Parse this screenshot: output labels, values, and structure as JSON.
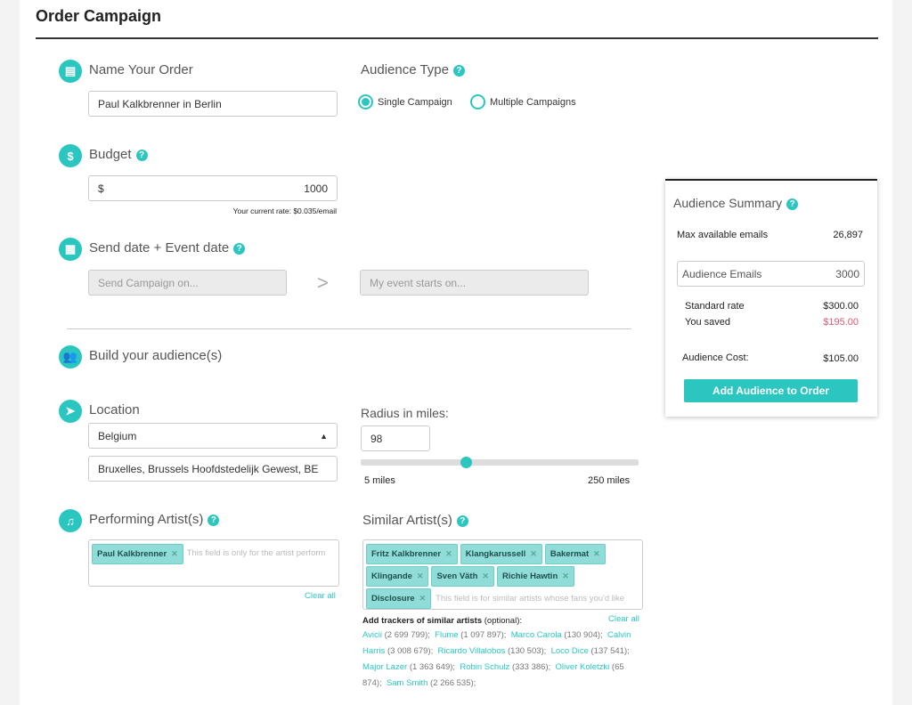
{
  "page_title": "Order Campaign",
  "name_order": {
    "label": "Name Your Order",
    "value": "Paul Kalkbrenner in Berlin"
  },
  "audience_type": {
    "label": "Audience Type",
    "options": [
      "Single Campaign",
      "Multiple Campaigns"
    ],
    "selected": "Single Campaign"
  },
  "budget": {
    "label": "Budget",
    "currency": "$",
    "value": "1000",
    "rate": "Your current rate: $0.035/email"
  },
  "dates": {
    "label": "Send date + Event date",
    "send_placeholder": "Send Campaign on...",
    "arrow": ">",
    "event_placeholder": "My event starts on..."
  },
  "build": {
    "label": "Build your audience(s)"
  },
  "location": {
    "label": "Location",
    "country": "Belgium",
    "city": "Bruxelles, Brussels Hoofdstedelijk Gewest, BE"
  },
  "radius": {
    "label": "Radius in miles:",
    "value": "98",
    "min_label": "5 miles",
    "max_label": "250 miles",
    "min": 5,
    "max": 250,
    "current": 98
  },
  "performing": {
    "label": "Performing Artist(s)",
    "tags": [
      "Paul Kalkbrenner"
    ],
    "placeholder": "This field is only for the artist perform",
    "clear": "Clear all"
  },
  "similar": {
    "label": "Similar Artist(s)",
    "tags": [
      "Fritz Kalkbrenner",
      "Klangkarussell",
      "Bakermat",
      "Klingande",
      "Sven Väth",
      "Richie Hawtin",
      "Disclosure"
    ],
    "placeholder": "This field is for similar artists whose fans you'd like",
    "clear": "Clear all",
    "trackers_title": "Add trackers of similar artists",
    "trackers_optional": "(optional):",
    "trackers": [
      {
        "name": "Avicii",
        "count": "(2 699 799);"
      },
      {
        "name": "Flume",
        "count": "(1 097 897);"
      },
      {
        "name": "Marco Carola",
        "count": "(130 904);"
      },
      {
        "name": "Calvin Harris",
        "count": "(3 008 679);"
      },
      {
        "name": "Ricardo Villalobos",
        "count": "(130 503);"
      },
      {
        "name": "Loco Dice",
        "count": "(137 541);"
      },
      {
        "name": "Major Lazer",
        "count": "(1 363 649);"
      },
      {
        "name": "Robin Schulz",
        "count": "(333 386);"
      },
      {
        "name": "Oliver Koletzki",
        "count": "(65 874);"
      },
      {
        "name": "Sam Smith",
        "count": "(2 266 535);"
      }
    ]
  },
  "summary": {
    "title": "Audience Summary",
    "max_label": "Max available emails",
    "max_value": "26,897",
    "emails_label": "Audience Emails",
    "emails_value": "3000",
    "standard_label": "Standard rate",
    "standard_value": "$300.00",
    "saved_label": "You saved",
    "saved_value": "$195.00",
    "cost_label": "Audience Cost:",
    "cost_value": "$105.00",
    "button": "Add Audience to Order"
  },
  "colors": {
    "accent": "#2cc6c0",
    "saved": "#e5566b"
  }
}
